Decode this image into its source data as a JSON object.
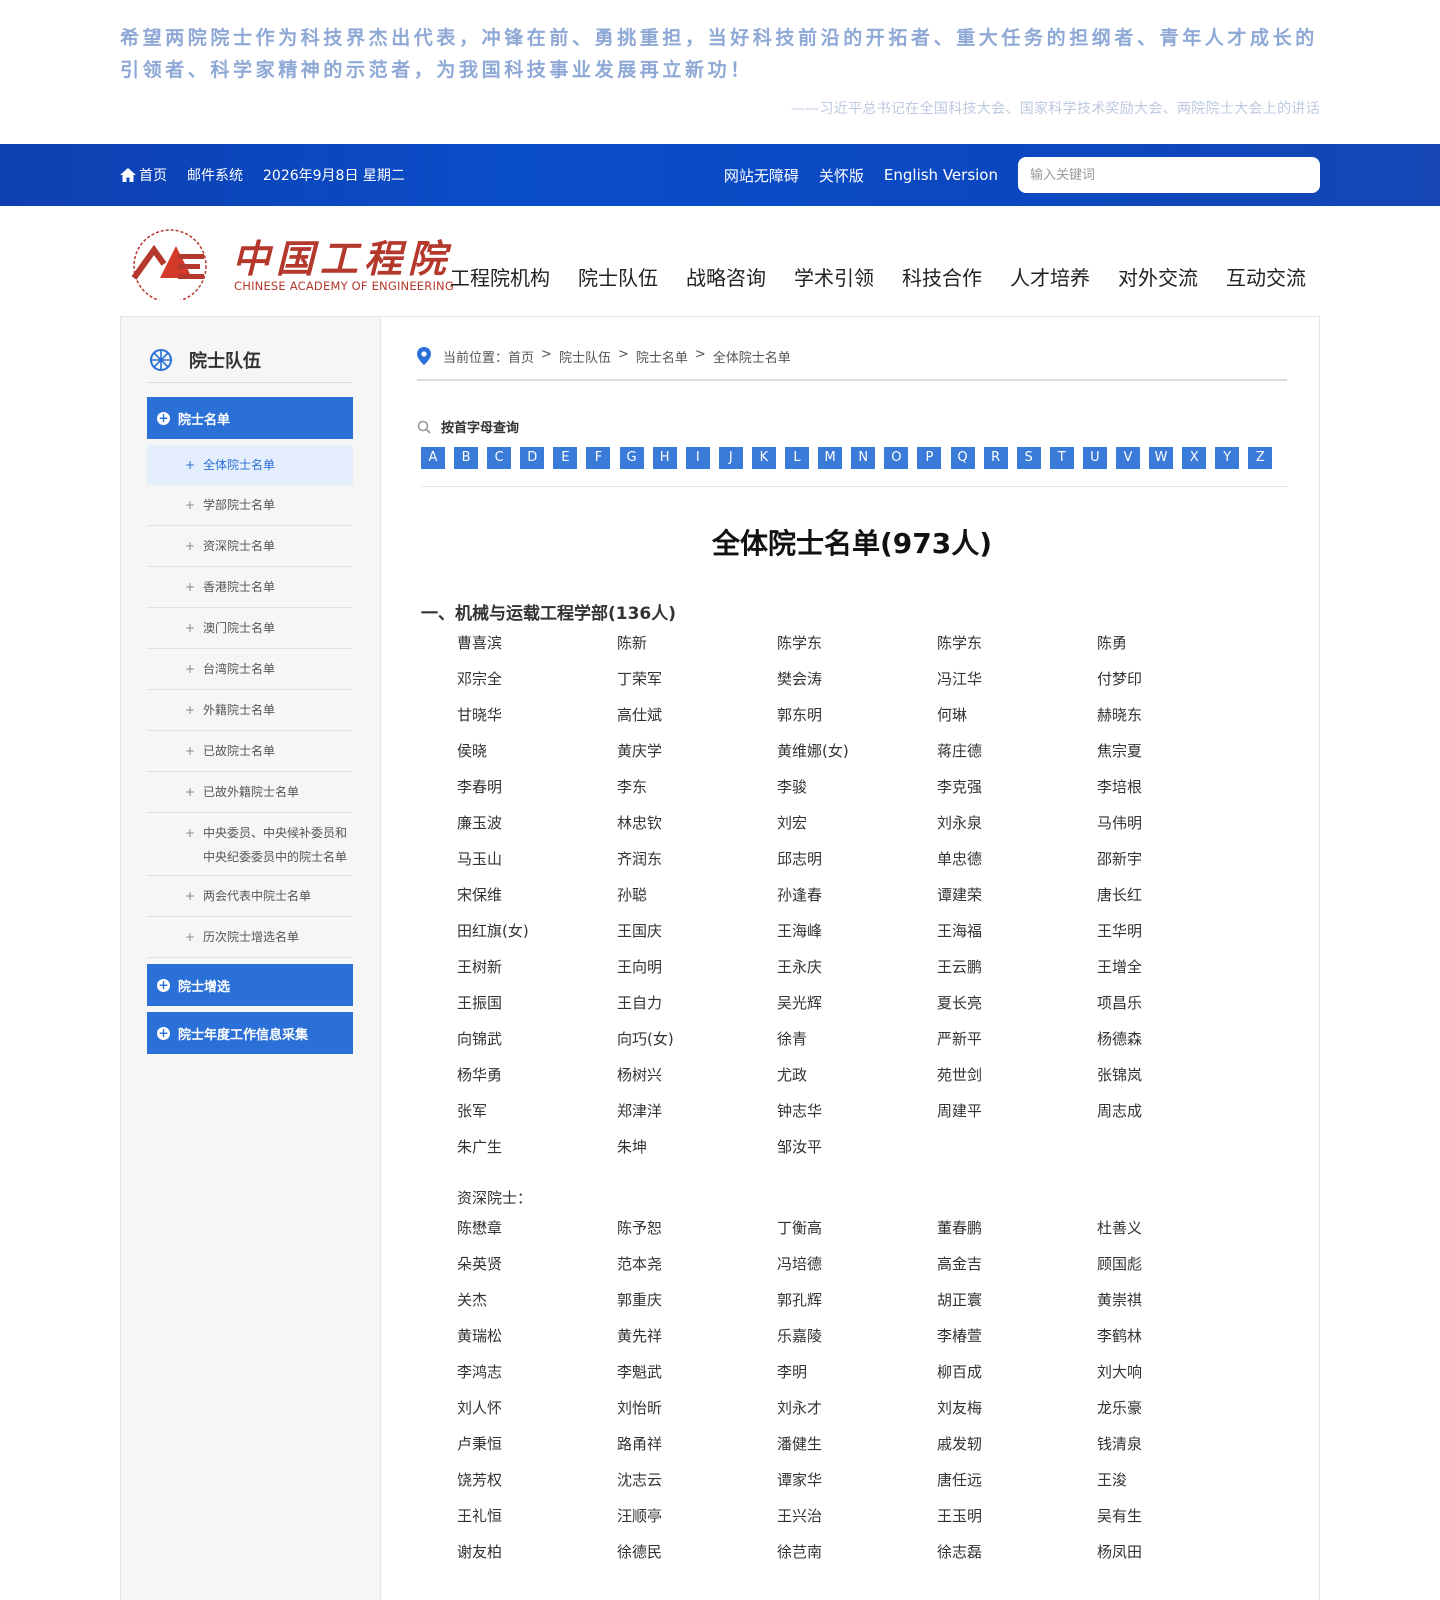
{
  "quote": {
    "text": "希望两院院士作为科技界杰出代表，冲锋在前、勇挑重担，当好科技前沿的开拓者、重大任务的担纲者、青年人才成长的引领者、科学家精神的示范者，为我国科技事业发展再立新功！",
    "source": "——习近平总书记在全国科技大会、国家科学技术奖励大会、两院院士大会上的讲话"
  },
  "topbar": {
    "home": "首页",
    "mail": "邮件系统",
    "date": "2026年9月8日 星期二",
    "accessibility": "网站无障碍",
    "care": "关怀版",
    "english": "English Version",
    "search_placeholder": "输入关键词"
  },
  "logo": {
    "cn": "中国工程院",
    "en": "CHINESE ACADEMY OF ENGINEERING"
  },
  "mainnav": [
    "工程院机构",
    "院士队伍",
    "战略咨询",
    "学术引领",
    "科技合作",
    "人才培养",
    "对外交流",
    "互动交流"
  ],
  "sidebar": {
    "title": "院士队伍",
    "main1": "院士名单",
    "subs": [
      "全体院士名单",
      "学部院士名单",
      "资深院士名单",
      "香港院士名单",
      "澳门院士名单",
      "台湾院士名单",
      "外籍院士名单",
      "已故院士名单",
      "已故外籍院士名单",
      "中央委员、中央候补委员和中央纪委委员中的院士名单",
      "两会代表中院士名单",
      "历次院士增选名单"
    ],
    "main2": "院士增选",
    "main3": "院士年度工作信息采集"
  },
  "breadcrumb": {
    "label": "当前位置：",
    "items": [
      "首页",
      "院士队伍",
      "院士名单",
      "全体院士名单"
    ]
  },
  "letter_search": {
    "label": "按首字母查询",
    "letters": [
      "A",
      "B",
      "C",
      "D",
      "E",
      "F",
      "G",
      "H",
      "I",
      "J",
      "K",
      "L",
      "M",
      "N",
      "O",
      "P",
      "Q",
      "R",
      "S",
      "T",
      "U",
      "V",
      "W",
      "X",
      "Y",
      "Z"
    ]
  },
  "page_title": "全体院士名单(973人)",
  "section": {
    "title": "一、机械与运载工程学部(136人)",
    "names": [
      "曹喜滨",
      "陈新",
      "陈学东",
      "陈学东",
      "陈勇",
      "邓宗全",
      "丁荣军",
      "樊会涛",
      "冯江华",
      "付梦印",
      "甘晓华",
      "高仕斌",
      "郭东明",
      "何琳",
      "赫晓东",
      "侯晓",
      "黄庆学",
      "黄维娜(女)",
      "蒋庄德",
      "焦宗夏",
      "李春明",
      "李东",
      "李骏",
      "李克强",
      "李培根",
      "廉玉波",
      "林忠钦",
      "刘宏",
      "刘永泉",
      "马伟明",
      "马玉山",
      "齐润东",
      "邱志明",
      "单忠德",
      "邵新宇",
      "宋保维",
      "孙聪",
      "孙逢春",
      "谭建荣",
      "唐长红",
      "田红旗(女)",
      "王国庆",
      "王海峰",
      "王海福",
      "王华明",
      "王树新",
      "王向明",
      "王永庆",
      "王云鹏",
      "王增全",
      "王振国",
      "王自力",
      "吴光辉",
      "夏长亮",
      "项昌乐",
      "向锦武",
      "向巧(女)",
      "徐青",
      "严新平",
      "杨德森",
      "杨华勇",
      "杨树兴",
      "尤政",
      "苑世剑",
      "张锦岚",
      "张军",
      "郑津洋",
      "钟志华",
      "周建平",
      "周志成",
      "朱广生",
      "朱坤",
      "邹汝平"
    ],
    "senior_label": "资深院士：",
    "senior_names": [
      "陈懋章",
      "陈予恕",
      "丁衡高",
      "董春鹏",
      "杜善义",
      "朵英贤",
      "范本尧",
      "冯培德",
      "高金吉",
      "顾国彪",
      "关杰",
      "郭重庆",
      "郭孔辉",
      "胡正寰",
      "黄崇祺",
      "黄瑞松",
      "黄先祥",
      "乐嘉陵",
      "李椿萱",
      "李鹤林",
      "李鸿志",
      "李魁武",
      "李明",
      "柳百成",
      "刘大响",
      "刘人怀",
      "刘怡昕",
      "刘永才",
      "刘友梅",
      "龙乐豪",
      "卢秉恒",
      "路甬祥",
      "潘健生",
      "戚发轫",
      "钱清泉",
      "饶芳权",
      "沈志云",
      "谭家华",
      "唐任远",
      "王浚",
      "王礼恒",
      "汪顺亭",
      "王兴治",
      "王玉明",
      "吴有生",
      "谢友柏",
      "徐德民",
      "徐芑南",
      "徐志磊",
      "杨凤田"
    ]
  },
  "colors": {
    "primary": "#2a70d7",
    "topbar": "#0a4dc8",
    "logo_red": "#b5382c"
  }
}
